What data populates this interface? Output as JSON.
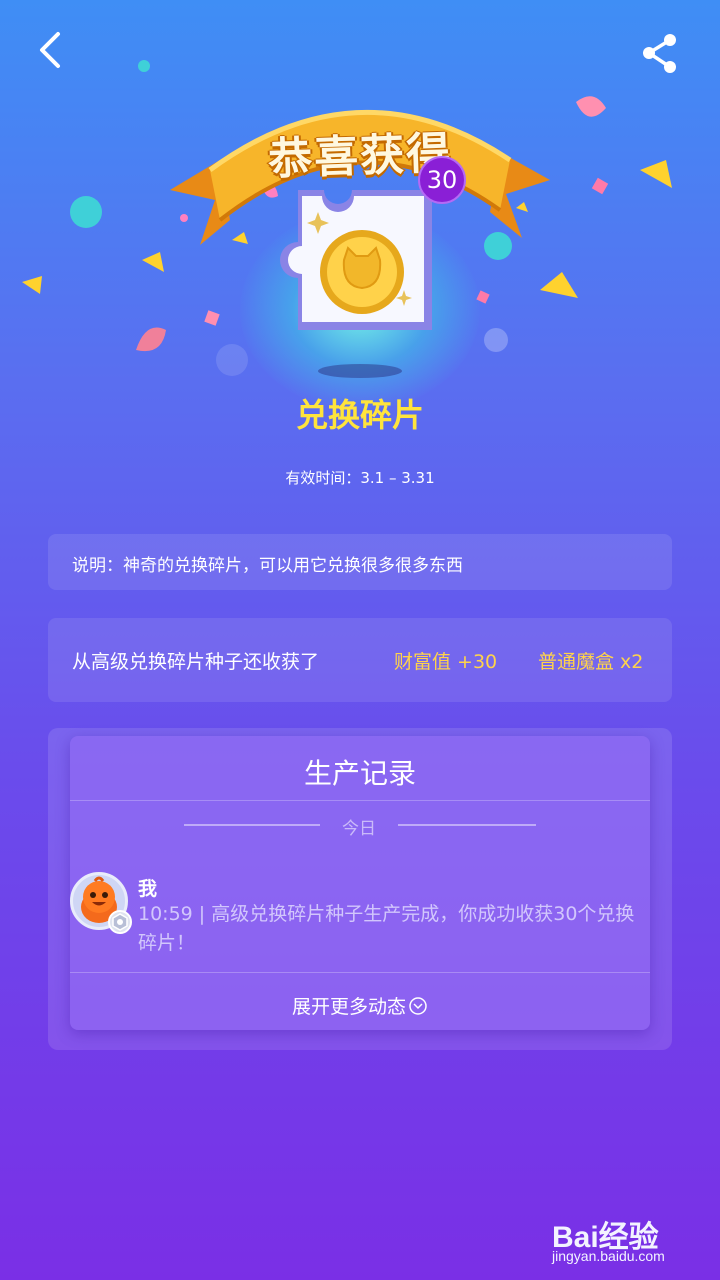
{
  "header": {
    "back_icon": "chevron-left-icon",
    "share_icon": "share-icon"
  },
  "hero": {
    "banner_text": "恭喜获得",
    "badge_count": "30",
    "item_icon": "puzzle-coin-icon"
  },
  "item": {
    "title": "兑换碎片",
    "validity": "有效时间：3.1 – 3.31"
  },
  "description": {
    "text": "说明：神奇的兑换碎片，可以用它兑换很多很多东西"
  },
  "harvest": {
    "text": "从高级兑换碎片种子还收获了",
    "rewards": [
      "财富值 +30",
      "普通魔盒 x2"
    ]
  },
  "records": {
    "title": "生产记录",
    "day_label": "今日",
    "entries": [
      {
        "name": "我",
        "text": "10:59 | 高级兑换碎片种子生产完成，你成功收获30个兑换碎片！"
      }
    ],
    "more_label": "展开更多动态"
  },
  "watermark": {
    "logo": "Bai经验",
    "url": "jingyan.baidu.com"
  },
  "colors": {
    "title_yellow": "#ffe43c",
    "reward_yellow": "#ffd34a",
    "badge_purple": "#8a1fd6",
    "ribbon_orange": "#f5a623"
  }
}
